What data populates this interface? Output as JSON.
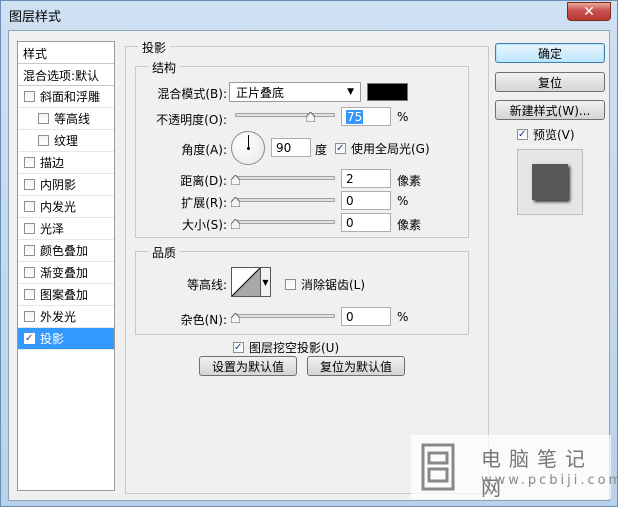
{
  "window": {
    "title": "图层样式",
    "close_glyph": "✕"
  },
  "style_list": {
    "header": "样式",
    "blend_options": "混合选项:默认",
    "items": [
      {
        "label": "斜面和浮雕",
        "checked": false,
        "sub": false,
        "selected": false
      },
      {
        "label": "等高线",
        "checked": false,
        "sub": true,
        "selected": false
      },
      {
        "label": "纹理",
        "checked": false,
        "sub": true,
        "selected": false
      },
      {
        "label": "描边",
        "checked": false,
        "sub": false,
        "selected": false
      },
      {
        "label": "内阴影",
        "checked": false,
        "sub": false,
        "selected": false
      },
      {
        "label": "内发光",
        "checked": false,
        "sub": false,
        "selected": false
      },
      {
        "label": "光泽",
        "checked": false,
        "sub": false,
        "selected": false
      },
      {
        "label": "颜色叠加",
        "checked": false,
        "sub": false,
        "selected": false
      },
      {
        "label": "渐变叠加",
        "checked": false,
        "sub": false,
        "selected": false
      },
      {
        "label": "图案叠加",
        "checked": false,
        "sub": false,
        "selected": false
      },
      {
        "label": "外发光",
        "checked": false,
        "sub": false,
        "selected": false
      },
      {
        "label": "投影",
        "checked": true,
        "sub": false,
        "selected": true
      }
    ]
  },
  "drop_shadow": {
    "title": "投影",
    "structure": {
      "title": "结构",
      "blend_mode_label": "混合模式(B):",
      "blend_mode_value": "正片叠底",
      "blend_color": "#000000",
      "opacity_label": "不透明度(O):",
      "opacity_value": "75",
      "opacity_fraction": 0.75,
      "percent": "%",
      "angle_label": "角度(A):",
      "angle_value": "90",
      "angle_unit": "度",
      "global_light_label": "使用全局光(G)",
      "global_light_checked": true,
      "distance_label": "距离(D):",
      "distance_value": "2",
      "distance_fraction": 0.0,
      "pixels": "像素",
      "spread_label": "扩展(R):",
      "spread_value": "0",
      "spread_fraction": 0.0,
      "size_label": "大小(S):",
      "size_value": "0",
      "size_fraction": 0.0
    },
    "quality": {
      "title": "品质",
      "contour_label": "等高线:",
      "anti_alias_label": "消除锯齿(L)",
      "anti_alias_checked": false,
      "noise_label": "杂色(N):",
      "noise_value": "0",
      "noise_fraction": 0.0
    },
    "knockout_label": "图层挖空投影(U)",
    "knockout_checked": true,
    "make_default": "设置为默认值",
    "reset_default": "复位为默认值"
  },
  "buttons": {
    "ok": "确定",
    "reset": "复位",
    "new_style": "新建样式(W)...",
    "preview_label": "预览(V)",
    "preview_checked": true
  },
  "watermark": {
    "text": "电脑笔记网",
    "url": "www.pcbiji.com"
  }
}
